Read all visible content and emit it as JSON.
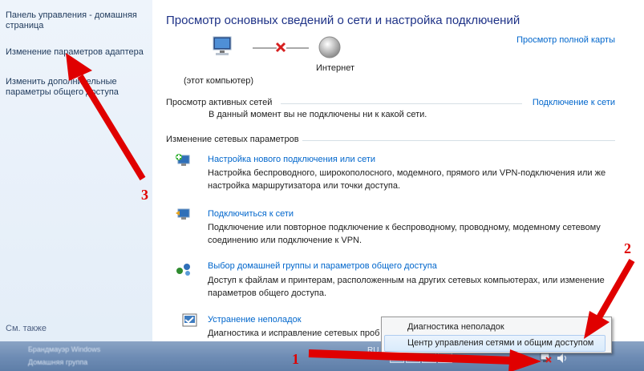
{
  "sidebar": {
    "home_link": "Панель управления - домашняя страница",
    "adapter_link": "Изменение параметров адаптера",
    "sharing_link": "Изменить дополнительные параметры общего доступа",
    "see_also": "См. также",
    "blurred_1": "Брандмауэр Windows",
    "blurred_2": "Домашняя группа"
  },
  "main": {
    "title": "Просмотр основных сведений о сети и настройка подключений",
    "full_map_link": "Просмотр полной карты",
    "this_computer": "(этот компьютер)",
    "internet": "Интернет",
    "active_networks": "Просмотр активных сетей",
    "not_connected": "В данный момент вы не подключены ни к какой сети.",
    "connect_to_network": "Подключение к сети",
    "change_settings": "Изменение сетевых параметров",
    "tasks": [
      {
        "title": "Настройка нового подключения или сети",
        "desc": "Настройка беспроводного, широкополосного, модемного, прямого или VPN-подключения или же настройка маршрутизатора или точки доступа."
      },
      {
        "title": "Подключиться к сети",
        "desc": "Подключение или повторное подключение к беспроводному, проводному, модемному сетевому соединению или подключение к VPN."
      },
      {
        "title": "Выбор домашней группы и параметров общего доступа",
        "desc": "Доступ к файлам и принтерам, расположенным на других сетевых компьютерах, или изменение параметров общего доступа."
      },
      {
        "title": "Устранение неполадок",
        "desc": "Диагностика и исправление сетевых проб"
      }
    ]
  },
  "context_menu": {
    "items": [
      "Диагностика неполадок",
      "Центр управления сетями и общим доступом"
    ]
  },
  "taskbar": {
    "lang": "RU"
  },
  "annotations": [
    "1",
    "2",
    "3"
  ],
  "colors": {
    "link": "#0066cc",
    "title": "#1e3287",
    "arrow": "#e00000",
    "sidebar": "#e3edf8"
  }
}
